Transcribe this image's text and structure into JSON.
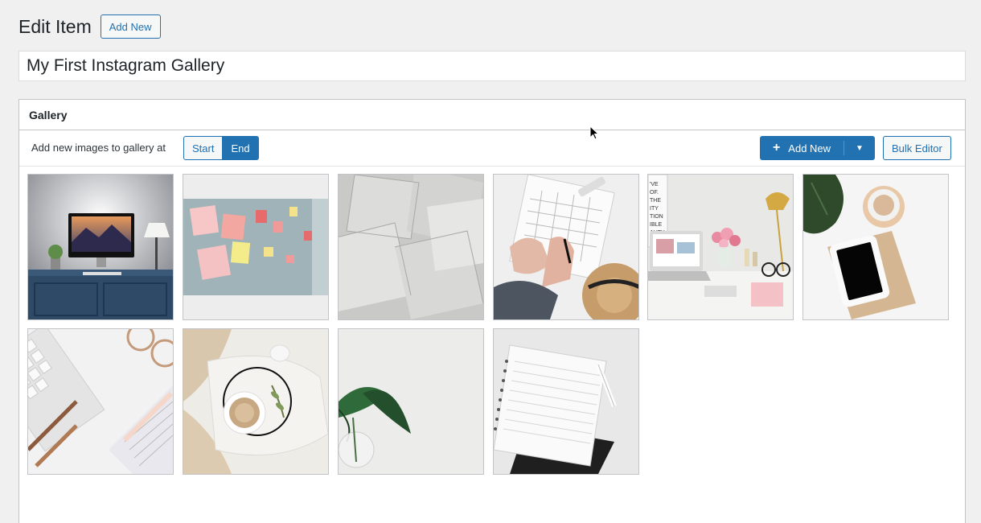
{
  "header": {
    "title": "Edit Item",
    "add_new_label": "Add New"
  },
  "post_title": {
    "value": "My First Instagram Gallery"
  },
  "gallery": {
    "heading": "Gallery",
    "toolbar": {
      "position_label": "Add new images to gallery at",
      "position_options": [
        "Start",
        "End"
      ],
      "selected_position": "End",
      "add_new_label": "Add New",
      "add_new_icon": "plus-icon",
      "dropdown_icon": "caret-down-icon",
      "bulk_editor_label": "Bulk Editor"
    },
    "images": [
      "imac-desk-photo",
      "sticky-notes-wall-photo",
      "paper-sheets-photo",
      "planner-hands-hat-photo",
      "desk-laptop-flowers-photo",
      "tablet-coffee-photo",
      "keyboard-pens-photo",
      "coffee-cup-blanket-photo",
      "plant-vase-photo",
      "notebooks-pen-photo"
    ]
  },
  "colors": {
    "accent": "#2271b1",
    "background": "#f0f0f1",
    "panel": "#ffffff",
    "border": "#c3c4c7"
  }
}
